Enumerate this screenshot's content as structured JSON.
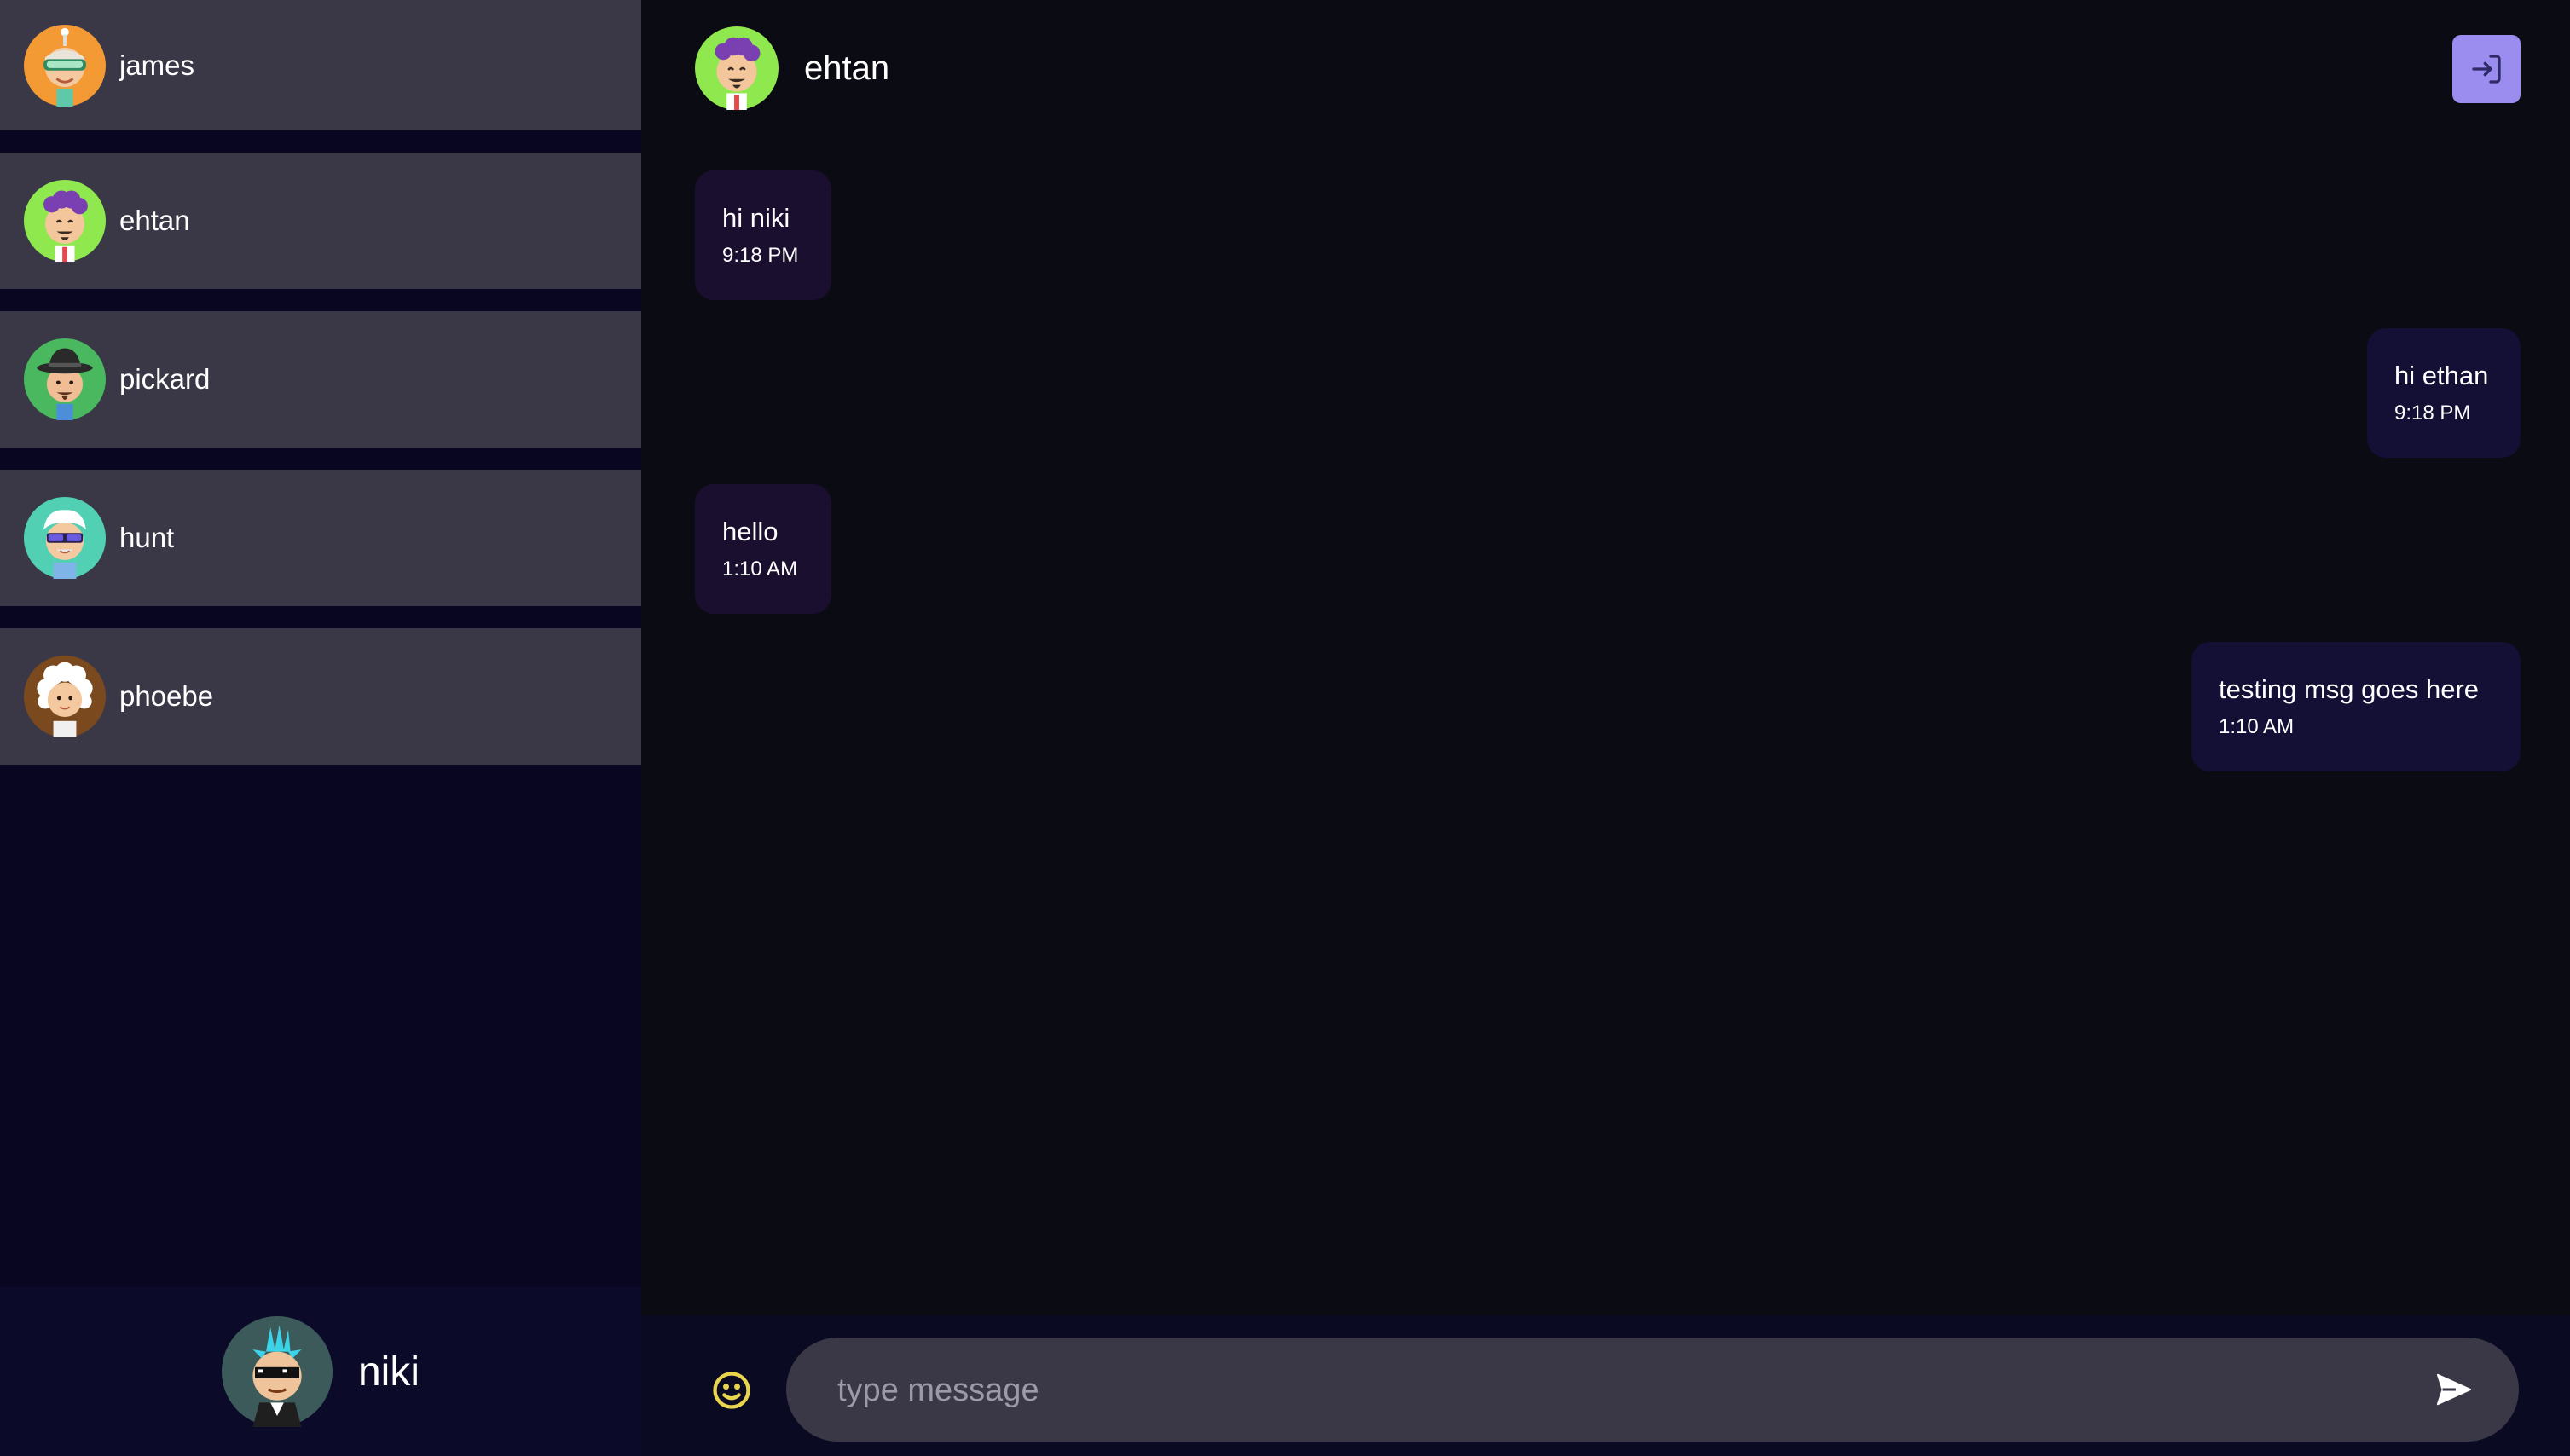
{
  "sidebar": {
    "contacts": [
      {
        "name": "james",
        "avatar": "avatar-orange-vr-goggles"
      },
      {
        "name": "ehtan",
        "avatar": "avatar-green-purple-hair"
      },
      {
        "name": "pickard",
        "avatar": "avatar-green-hat"
      },
      {
        "name": "hunt",
        "avatar": "avatar-teal-sunglasses"
      },
      {
        "name": "phoebe",
        "avatar": "avatar-brown-white-hair"
      }
    ],
    "current_user": {
      "name": "niki",
      "avatar": "avatar-slate-mohawk-shades"
    }
  },
  "chat": {
    "header": {
      "name": "ehtan",
      "avatar": "avatar-green-purple-hair"
    },
    "logout_icon": "logout-icon",
    "messages": [
      {
        "direction": "incoming",
        "text": "hi niki",
        "time": "9:18 PM"
      },
      {
        "direction": "outgoing",
        "text": "hi ethan",
        "time": "9:18 PM"
      },
      {
        "direction": "incoming",
        "text": "hello",
        "time": "1:10 AM"
      },
      {
        "direction": "outgoing",
        "text": "testing msg goes here",
        "time": "1:10 AM"
      }
    ]
  },
  "composer": {
    "placeholder": "type message",
    "value": "",
    "emoji_icon": "smiley-icon",
    "send_icon": "send-icon"
  },
  "colors": {
    "sidebar_bg": "#080620",
    "contact_bg": "#3a3847",
    "chat_bg": "#0b0b13",
    "incoming_bubble": "#1a0f2f",
    "outgoing_bubble": "#130f35",
    "accent": "#9b8cf0",
    "emoji_yellow": "#e8d44d"
  }
}
